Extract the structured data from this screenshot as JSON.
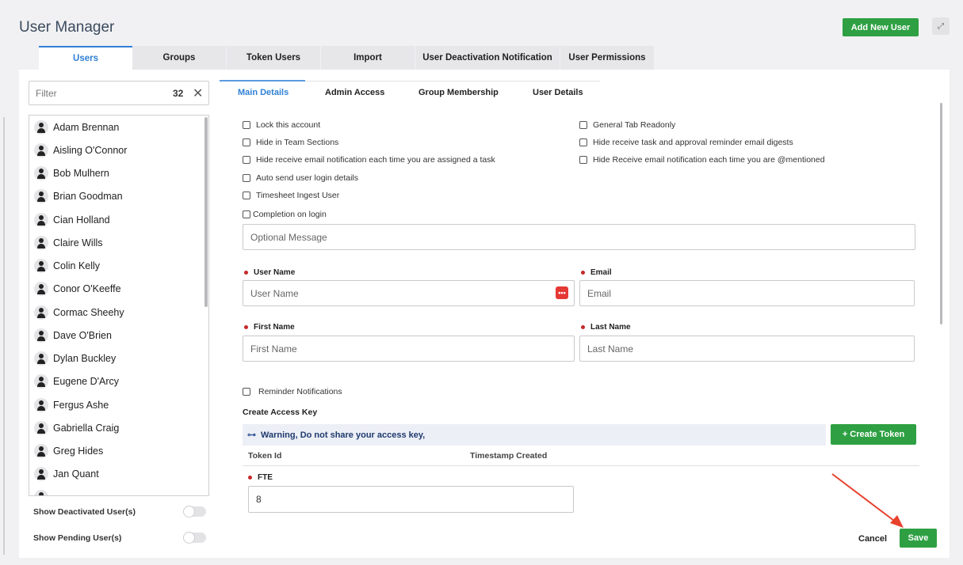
{
  "header": {
    "title": "User Manager",
    "add_user_label": "Add New User",
    "expand_icon": "expand-icon"
  },
  "top_tabs": [
    {
      "label": "Users",
      "active": true
    },
    {
      "label": "Groups"
    },
    {
      "label": "Token Users"
    },
    {
      "label": "Import"
    },
    {
      "label": "User Deactivation Notification"
    },
    {
      "label": "User Permissions"
    }
  ],
  "filter": {
    "placeholder": "Filter",
    "count": "32",
    "clear_icon": "✕"
  },
  "users": [
    "Adam Brennan",
    "Aisling O'Connor",
    "Bob Mulhern",
    "Brian Goodman",
    "Cian Holland",
    "Claire Wills",
    "Colin Kelly",
    "Conor O'Keeffe",
    "Cormac Sheehy",
    "Dave O'Brien",
    "Dylan Buckley",
    "Eugene D'Arcy",
    "Fergus Ashe",
    "Gabriella Craig",
    "Greg Hides",
    "Jan Quant"
  ],
  "toggles": {
    "show_deactivated": "Show Deactivated User(s)",
    "show_pending": "Show Pending User(s)"
  },
  "sub_tabs": [
    {
      "label": "Main Details",
      "active": true
    },
    {
      "label": "Admin Access"
    },
    {
      "label": "Group Membership"
    },
    {
      "label": "User Details"
    }
  ],
  "checkboxes_left": [
    "Lock this account",
    "Hide in Team Sections",
    "Hide receive email notification each time you are assigned a task",
    "Auto send user login details",
    "Timesheet Ingest User",
    "Completion on login"
  ],
  "checkboxes_right": [
    "General Tab Readonly",
    "Hide receive task and approval reminder email digests",
    "Hide Receive email notification each time you are @mentioned"
  ],
  "form": {
    "optional_message_placeholder": "Optional Message",
    "user_name_label": "User Name",
    "user_name_placeholder": "User Name",
    "email_label": "Email",
    "email_placeholder": "Email",
    "first_name_label": "First Name",
    "first_name_placeholder": "First Name",
    "last_name_label": "Last Name",
    "last_name_placeholder": "Last Name",
    "reminder_notifications": "Reminder Notifications",
    "create_access_key": "Create Access Key",
    "warning_text": "Warning, Do not share your access key,",
    "create_token_label": "+ Create Token",
    "col_token_id": "Token Id",
    "col_timestamp": "Timestamp Created",
    "fte_label": "FTE",
    "fte_value": "8"
  },
  "actions": {
    "cancel": "Cancel",
    "save": "Save"
  },
  "colors": {
    "primary_green": "#2ea043",
    "tab_blue": "#2f80d5",
    "required_red": "#c62828",
    "annotation_arrow": "#e8412c"
  }
}
